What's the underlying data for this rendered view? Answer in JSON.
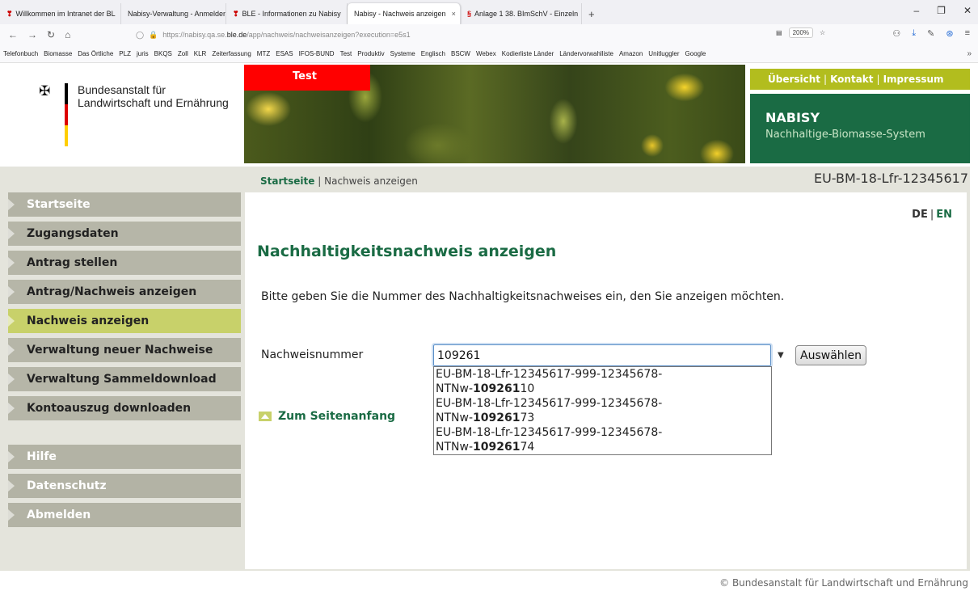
{
  "browser": {
    "tabs": [
      {
        "label": "Willkommen im Intranet der BL",
        "fav": "❣"
      },
      {
        "label": "Nabisy-Verwaltung - Anmelden",
        "fav": ""
      },
      {
        "label": "BLE - Informationen zu Nabisy",
        "fav": "❣"
      },
      {
        "label": "Nabisy - Nachweis anzeigen",
        "fav": ""
      },
      {
        "label": "Anlage 1 38. BImSchV - Einzeln",
        "fav": "§"
      }
    ],
    "url_prefix": "https://nabisy.qa.se.",
    "url_host": "ble.de",
    "url_path": "/app/nachweis/nachweisanzeigen?execution=e5s1",
    "zoom": "200%",
    "bookmarks": [
      "Telefonbuch",
      "Biomasse",
      "Das Örtliche",
      "PLZ",
      "juris",
      "BKQS",
      "Zoll",
      "KLR",
      "Zeiterfassung",
      "MTZ",
      "ESAS",
      "IFOS-BUND",
      "Test",
      "Produktiv",
      "Systeme",
      "Englisch",
      "BSCW",
      "Webex",
      "Kodierliste Länder",
      "Ländervorwahlliste",
      "Amazon",
      "Unitluggler",
      "Google"
    ]
  },
  "header": {
    "org_line1": "Bundesanstalt für",
    "org_line2": "Landwirtschaft und Ernährung",
    "test_badge": "Test",
    "links": [
      "Übersicht",
      "Kontakt",
      "Impressum"
    ],
    "app_name": "NABISY",
    "app_subtitle": "Nachhaltige-Biomasse-System"
  },
  "breadcrumb": {
    "home": "Startseite",
    "sep": "|",
    "current": "Nachweis anzeigen"
  },
  "account_id": "EU-BM-18-Lfr-12345617",
  "sidebar": {
    "items": [
      {
        "label": "Startseite"
      },
      {
        "label": "Zugangsdaten"
      },
      {
        "label": "Antrag stellen"
      },
      {
        "label": "Antrag/Nachweis anzeigen"
      },
      {
        "label": "Nachweis anzeigen"
      },
      {
        "label": "Verwaltung neuer Nachweise"
      },
      {
        "label": "Verwaltung Sammeldownload"
      },
      {
        "label": "Kontoauszug downloaden"
      }
    ],
    "bottom": [
      {
        "label": "Hilfe"
      },
      {
        "label": "Datenschutz"
      },
      {
        "label": "Abmelden"
      }
    ]
  },
  "lang": {
    "de": "DE",
    "sep": "|",
    "en": "EN"
  },
  "main": {
    "title": "Nachhaltigkeitsnachweis anzeigen",
    "intro": "Bitte geben Sie die Nummer des Nachhaltigkeitsnachweises ein, den Sie anzeigen möchten.",
    "field_label": "Nachweisnummer",
    "field_value": "109261",
    "button": "Auswählen",
    "suggestions": [
      {
        "line1": "EU-BM-18-Lfr-12345617-999-12345678-",
        "prefix": "NTNw-",
        "match": "109261",
        "rest": "10"
      },
      {
        "line1": "EU-BM-18-Lfr-12345617-999-12345678-",
        "prefix": "NTNw-",
        "match": "109261",
        "rest": "73"
      },
      {
        "line1": "EU-BM-18-Lfr-12345617-999-12345678-",
        "prefix": "NTNw-",
        "match": "109261",
        "rest": "74"
      }
    ],
    "to_top": "Zum Seitenanfang"
  },
  "footer": "© Bundesanstalt für Landwirtschaft und Ernährung"
}
